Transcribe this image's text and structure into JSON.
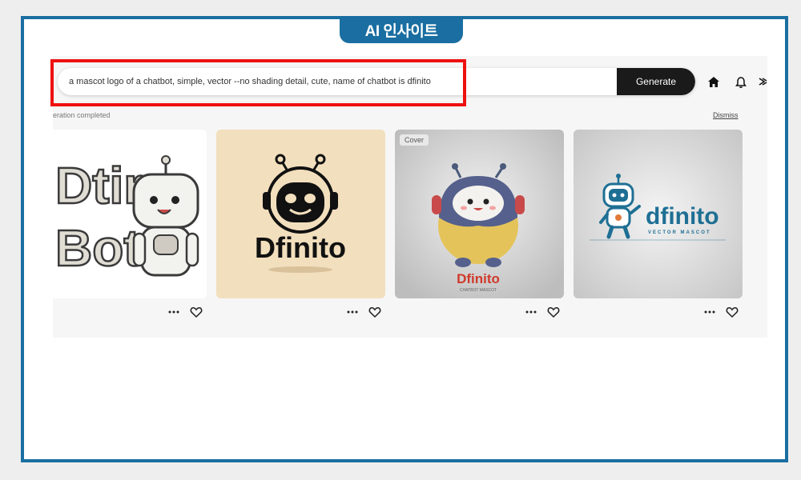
{
  "brand": {
    "label": "AI 인사이트"
  },
  "search": {
    "prompt": "a mascot logo of a chatbot, simple, vector --no shading detail, cute, name of chatbot is dfinito",
    "generate_label": "Generate"
  },
  "status": {
    "text": "eration completed",
    "dismiss_label": "Dismiss"
  },
  "cards": [
    {
      "name_line1": "Dtir",
      "name_line2": "Bot"
    },
    {
      "name": "Dfinito"
    },
    {
      "name": "Dfinito",
      "subtitle": "CHATBOT MASCOT",
      "badge": "Cover"
    },
    {
      "name": "dfinito",
      "subtitle": "VECTOR MASCOT"
    }
  ],
  "colors": {
    "frame": "#1a6ea1",
    "highlight": "#ee1010",
    "generate_bg": "#1a1a1a",
    "card2_bg": "#f2dfbd",
    "card4_text": "#1e6f94"
  },
  "icons": [
    "home-icon",
    "bell-icon",
    "menu-icon",
    "more-icon",
    "heart-icon"
  ]
}
